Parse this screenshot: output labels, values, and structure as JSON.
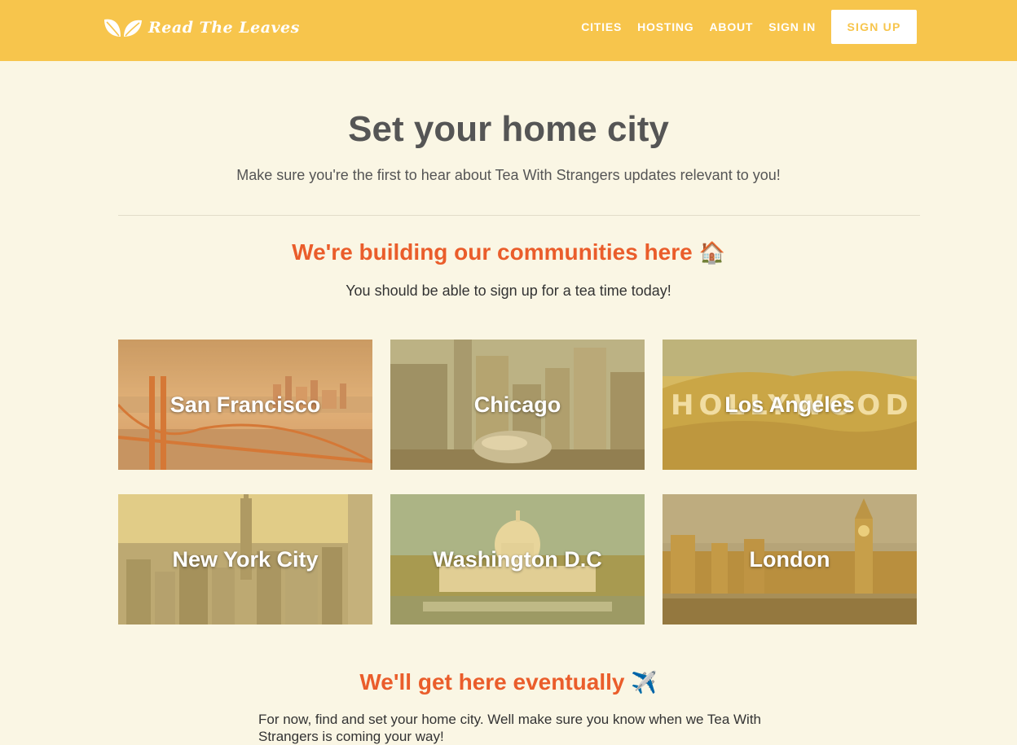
{
  "brand": {
    "name": "Read The Leaves",
    "logo_icon": "leaves-icon"
  },
  "nav": {
    "links": [
      "CITIES",
      "HOSTING",
      "ABOUT",
      "SIGN IN"
    ],
    "signup_label": "SIGN UP"
  },
  "header": {
    "title": "Set your home city",
    "subtitle": "Make sure you're the first to hear about Tea With Strangers updates relevant to you!"
  },
  "building": {
    "heading": "We're building our communities here",
    "emoji": "🏠",
    "text": "You should be able to sign up for a tea time today!"
  },
  "cities": [
    {
      "name": "San Francisco",
      "image": "golden-gate-bridge"
    },
    {
      "name": "Chicago",
      "image": "chicago-bean-skyline"
    },
    {
      "name": "Los Angeles",
      "image": "hollywood-sign"
    },
    {
      "name": "New York City",
      "image": "manhattan-skyline"
    },
    {
      "name": "Washington D.C",
      "image": "us-capitol"
    },
    {
      "name": "London",
      "image": "big-ben-parliament"
    }
  ],
  "eventually": {
    "heading": "We'll get here eventually",
    "emoji": "✈️",
    "text": "For now, find and set your home city. Well make sure you know when we Tea With Strangers is coming your way!"
  },
  "colors": {
    "navbar": "#f7c54c",
    "background": "#faf6e4",
    "accent": "#ea5d2b",
    "heading": "#555555"
  }
}
